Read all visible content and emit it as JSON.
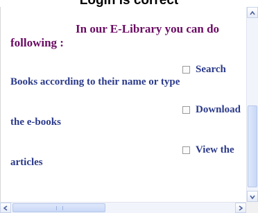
{
  "header": {
    "title": "Login is correct"
  },
  "content": {
    "intro_line1": "In our E-Library you can do",
    "intro_line2": "following :",
    "options": [
      {
        "label": "Search",
        "description": "Books according to their name or type",
        "checked": false
      },
      {
        "label": "Download",
        "description": "the e-books",
        "checked": false
      },
      {
        "label": "View the",
        "description": "articles",
        "checked": false
      }
    ]
  },
  "icons": {
    "scroll_up": "chevron-up-icon",
    "scroll_down": "chevron-down-icon",
    "scroll_left": "chevron-left-icon",
    "scroll_right": "chevron-right-icon"
  },
  "colors": {
    "heading": "#6a0b63",
    "text": "#2b3a8a",
    "scroll_arrow": "#4a5f9a"
  }
}
